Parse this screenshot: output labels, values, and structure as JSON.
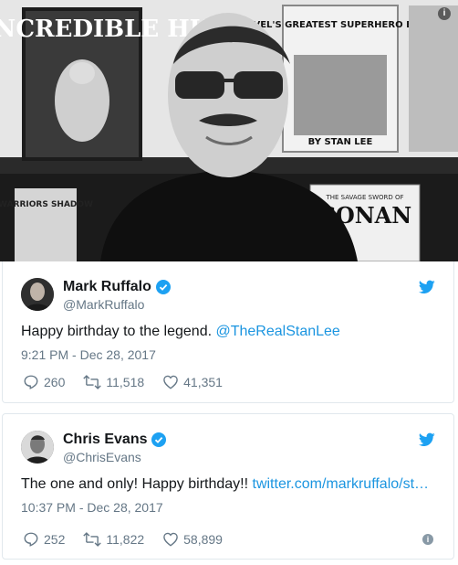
{
  "top_photo": {
    "comic_left_title": "THE INCREDIBLE HULK",
    "comic_right_title": "MARVEL'S GREATEST SUPERHERO BATTLES",
    "comic_right_byline": "BY STAN LEE",
    "comic_bottom_left": "WARRIORS SHADOW",
    "comic_bottom_right_small": "THE SAVAGE SWORD OF",
    "comic_bottom_right_title": "CONAN"
  },
  "tweets": [
    {
      "name": "Mark Ruffalo",
      "handle": "@MarkRuffalo",
      "text_prefix": "Happy birthday to the legend.",
      "text_link": "@TheRealStanLee",
      "timestamp": "9:21 PM - Dec 28, 2017",
      "replies": "260",
      "retweets": "11,518",
      "likes": "41,351"
    },
    {
      "name": "Chris Evans",
      "handle": "@ChrisEvans",
      "text_prefix": "The one and only! Happy birthday!!",
      "text_link": "twitter.com/markruffalo/st…",
      "timestamp": "10:37 PM - Dec 28, 2017",
      "replies": "252",
      "retweets": "11,822",
      "likes": "58,899"
    }
  ],
  "icons": {
    "top_info": "info-icon",
    "verified": "verified-badge-icon",
    "brand": "twitter-bird-icon",
    "reply": "reply-icon",
    "retweet": "retweet-icon",
    "like": "heart-icon"
  },
  "colors": {
    "twitter_blue": "#1da1f2",
    "link_blue": "#1b95e0",
    "muted_gray": "#657786"
  }
}
